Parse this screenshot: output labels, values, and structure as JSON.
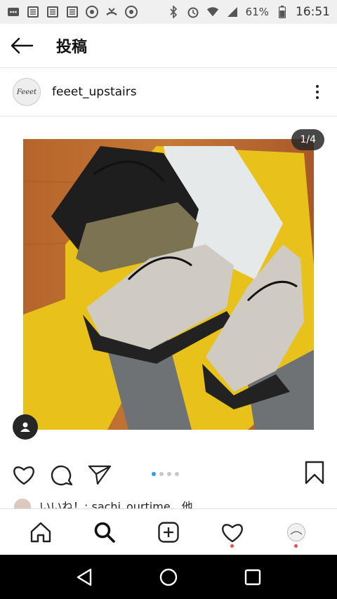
{
  "status_bar": {
    "battery": "61%",
    "time": "16:51"
  },
  "header": {
    "title": "投稿"
  },
  "post": {
    "username": "feeet_upstairs",
    "avatar_text": "Feeet",
    "image_counter": "1/4",
    "likes_text": "いいね！: sachi_ourtime、他"
  },
  "carousel": {
    "total": 4,
    "active": 1
  },
  "bottom_nav": {
    "items": [
      "home-icon",
      "search-icon",
      "add-icon",
      "activity-icon",
      "profile-avatar"
    ]
  },
  "colors": {
    "accent_blue": "#3897f0",
    "notification_red": "#ed4956"
  }
}
